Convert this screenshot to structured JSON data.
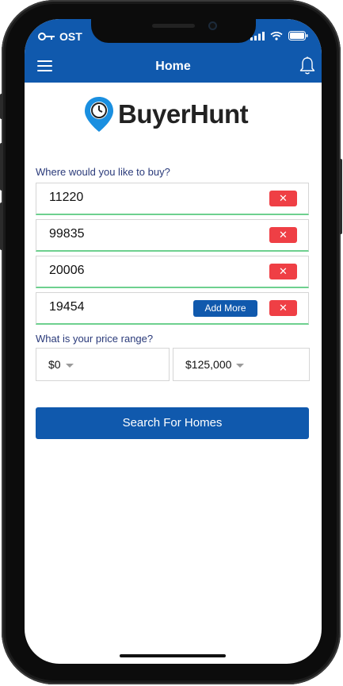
{
  "status_bar": {
    "carrier": "OST"
  },
  "nav": {
    "title": "Home"
  },
  "brand": {
    "name": "BuyerHunt",
    "accent": "#1059ad",
    "icon_accent": "#1a8fe0"
  },
  "location_section": {
    "label": "Where would you like to buy?",
    "zip_codes": [
      {
        "value": "11220",
        "remove_label": "✕"
      },
      {
        "value": "99835",
        "remove_label": "✕"
      },
      {
        "value": "20006",
        "remove_label": "✕"
      },
      {
        "value": "19454",
        "remove_label": "✕",
        "add_more_label": "Add More"
      }
    ]
  },
  "price_section": {
    "label": "What is your price range?",
    "min_price": "$0",
    "max_price": "$125,000"
  },
  "search_button": {
    "label": "Search For Homes"
  },
  "colors": {
    "primary": "#1059ad",
    "danger": "#ef3f45",
    "valid_underline": "#6ed08f"
  }
}
